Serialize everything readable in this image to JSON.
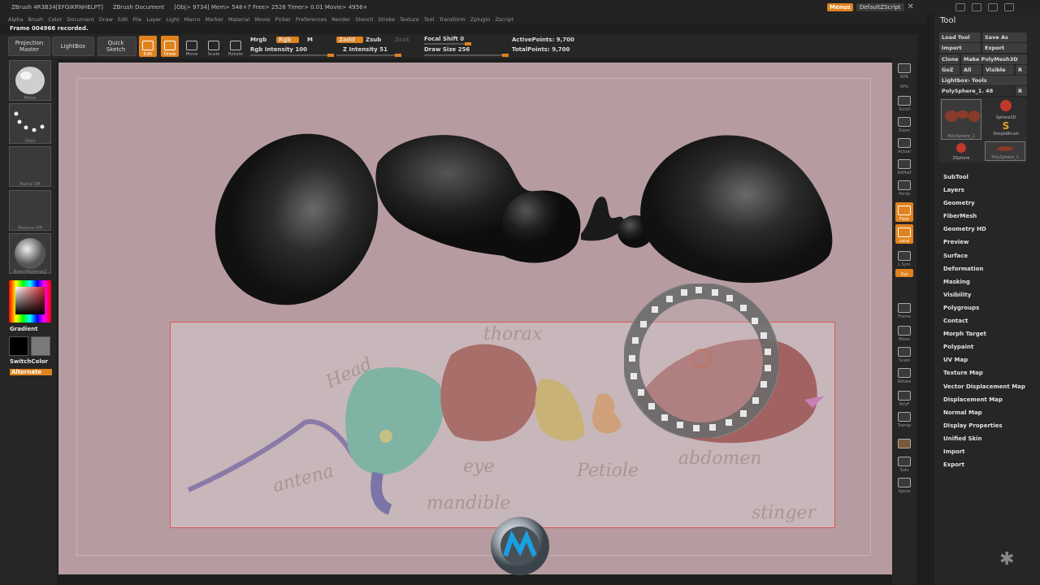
{
  "titlebar": {
    "app": "ZBrush 4R3B34[EFGIKRNHELPT]",
    "document": "ZBrush Document",
    "stats": "[Obj> 9734] Mem> 548+7 Free> 2526 Timer> 0.01 Movie> 4956+"
  },
  "menubar": [
    "Alpha",
    "Brush",
    "Color",
    "Document",
    "Draw",
    "Edit",
    "File",
    "Layer",
    "Light",
    "Macro",
    "Marker",
    "Material",
    "Movie",
    "Picker",
    "Preferences",
    "Render",
    "Stencil",
    "Stroke",
    "Texture",
    "Tool",
    "Transform",
    "Zplugin",
    "Zscript"
  ],
  "top_right": {
    "menus": "Menus",
    "script": "DefaultZScript"
  },
  "status": "Frame 004966 recorded.",
  "shelf": {
    "projection_master": "Projection Master",
    "lightbox": "LightBox",
    "quick_sketch": "Quick Sketch",
    "tools": [
      "Edit",
      "Draw",
      "Move",
      "Scale",
      "Rotate"
    ],
    "mrgb": "Mrgb",
    "rgb": "Rgb",
    "m": "M",
    "rgb_intensity": "Rgb Intensity 100",
    "zadd": "Zadd",
    "zsub": "Zsub",
    "zcut": "Zcut",
    "z_intensity": "Z Intensity 51",
    "focal_shift": "Focal Shift 0",
    "draw_size": "Draw Size 256",
    "active_points": "ActivePoints: 9,700",
    "total_points": "TotalPoints: 9,700"
  },
  "left_tray": {
    "thumbs": [
      "Move",
      "Dots",
      "Alpha Off",
      "Texture Off",
      "BasicMaterial2"
    ],
    "gradient": "Gradient",
    "switch_color": "SwitchColor",
    "alternate": "Alternate"
  },
  "right_tray": [
    "BPR",
    "SPix",
    "Scroll",
    "Zoom",
    "Actual",
    "AAHalf",
    "Persp",
    "Floor",
    "Local",
    "L.Sym",
    "Xyz",
    "Frame",
    "Move",
    "Scale",
    "Rotate",
    "PolyF",
    "Transp",
    "Ghost",
    "Solo",
    "Xpose"
  ],
  "tool_panel": {
    "title": "Tool",
    "buttons": [
      "Load Tool",
      "Save As",
      "Import",
      "Export",
      "Clone",
      "Make PolyMesh3D",
      "GoZ",
      "All",
      "Visible",
      "R",
      "Lightbox› Tools"
    ],
    "current": "PolySphere_1. 48",
    "r": "R",
    "tool_thumbs": [
      "PolySphere_1",
      "Sphere3D",
      "SimpleBrush",
      "ZSphere",
      "PolySphere_1"
    ],
    "subpalettes": [
      "SubTool",
      "Layers",
      "Geometry",
      "FiberMesh",
      "Geometry HD",
      "Preview",
      "Surface",
      "Deformation",
      "Masking",
      "Visibility",
      "Polygroups",
      "Contact",
      "Morph Target",
      "Polypaint",
      "UV Map",
      "Texture Map",
      "Vector Displacement Map",
      "Displacement Map",
      "Normal Map",
      "Display Properties",
      "Unified Skin",
      "Import",
      "Export"
    ]
  },
  "reference_labels": [
    "Head",
    "thorax",
    "eye",
    "antena",
    "mandible",
    "Petiole",
    "abdomen",
    "stinger"
  ],
  "colors": {
    "accent": "#e0821e",
    "canvas": "#b69ca0",
    "head": "#7fb3a4",
    "thorax": "#a86e6a",
    "abdomen": "#a36262"
  }
}
